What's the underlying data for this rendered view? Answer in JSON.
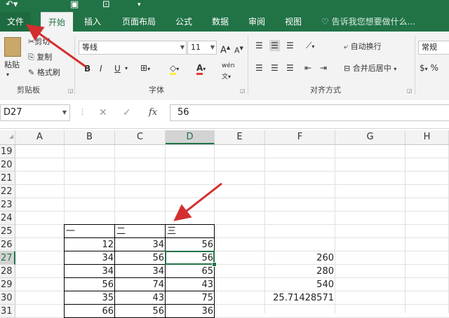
{
  "quick_access": {
    "undo_icon": "undo-icon",
    "save_icon": "save-icon",
    "preview_icon": "print-preview-icon"
  },
  "tabs": [
    {
      "label": "文件"
    },
    {
      "label": "开始"
    },
    {
      "label": "插入"
    },
    {
      "label": "页面布局"
    },
    {
      "label": "公式"
    },
    {
      "label": "数据"
    },
    {
      "label": "审阅"
    },
    {
      "label": "视图"
    }
  ],
  "tell_me": "告诉我您想要做什么...",
  "clipboard": {
    "paste": "粘贴",
    "cut": "剪切",
    "copy": "复制",
    "format_painter": "格式刷",
    "group": "剪贴板"
  },
  "font": {
    "name": "等线",
    "size": "11",
    "group": "字体",
    "bold": "B",
    "italic": "I",
    "underline": "U",
    "grow": "A",
    "shrink": "A",
    "phonetic": "wén"
  },
  "alignment": {
    "wrap": "自动换行",
    "merge": "合并后居中",
    "group": "对齐方式"
  },
  "number": {
    "format": "常规"
  },
  "formula_bar": {
    "name_box": "D27",
    "cancel": "✕",
    "enter": "✓",
    "fx": "fx",
    "value": "56"
  },
  "columns": [
    "A",
    "B",
    "C",
    "D",
    "E",
    "F",
    "G",
    "H"
  ],
  "selected_column": "D",
  "rows": [
    "19",
    "20",
    "21",
    "22",
    "23",
    "24",
    "25",
    "26",
    "27",
    "28",
    "29",
    "30",
    "31"
  ],
  "selected_row": "27",
  "cells": {
    "r25": {
      "B": "一",
      "C": "二",
      "D": "三"
    },
    "r26": {
      "B": "12",
      "C": "34",
      "D": "56"
    },
    "r27": {
      "B": "34",
      "C": "56",
      "D": "56",
      "F": "260"
    },
    "r28": {
      "B": "34",
      "C": "34",
      "D": "65",
      "F": "280"
    },
    "r29": {
      "B": "56",
      "C": "74",
      "D": "43",
      "F": "540"
    },
    "r30": {
      "B": "35",
      "C": "43",
      "D": "75",
      "F": "25.71428571"
    },
    "r31": {
      "B": "66",
      "C": "56",
      "D": "36"
    }
  },
  "colors": {
    "brand": "#217346",
    "arrow": "#d32f2f",
    "font_color": "#e53935",
    "highlight": "#ffeb3b"
  }
}
